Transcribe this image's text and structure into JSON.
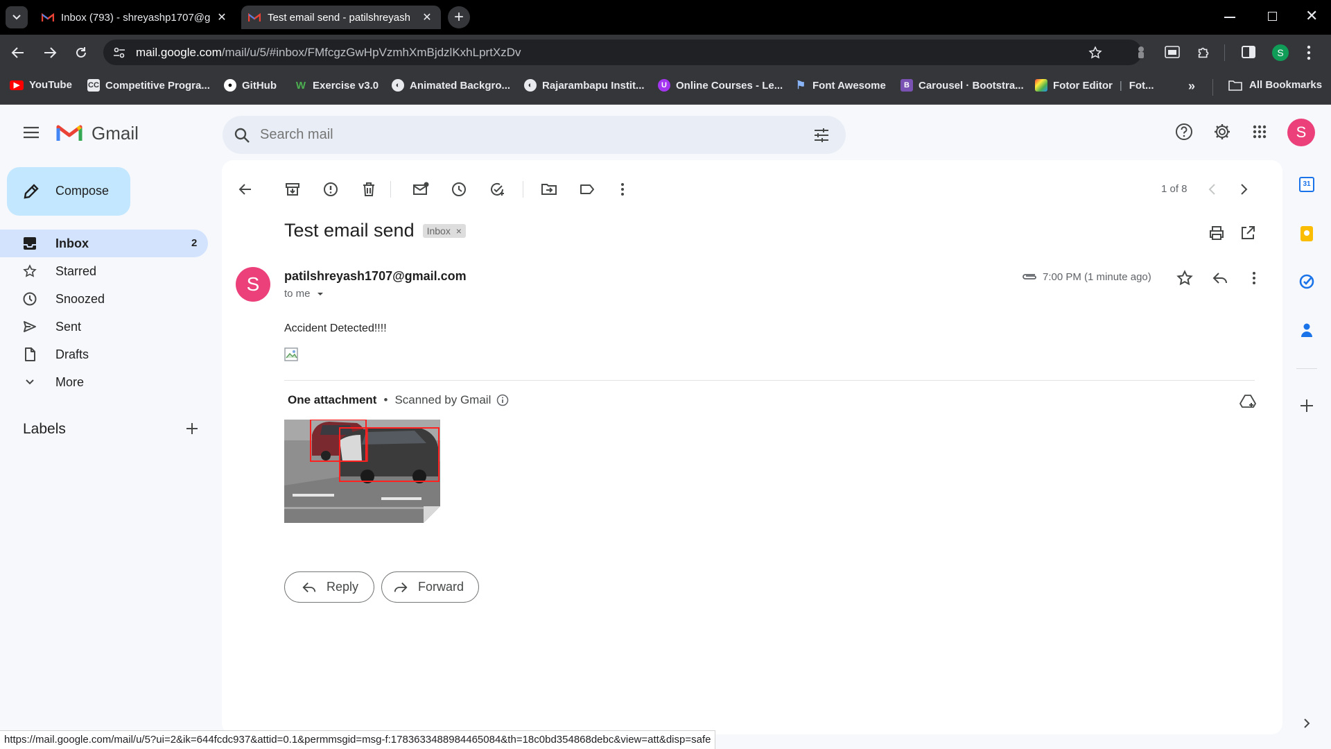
{
  "browser": {
    "tabs": [
      {
        "title": "Inbox (793) - shreyashp1707@g"
      },
      {
        "title": "Test email send - patilshreyash"
      }
    ],
    "url_host": "mail.google.com",
    "url_path": "/mail/u/5/#inbox/FMfcgzGwHpVzmhXmBjdzlKxhLprtXzDv",
    "profile_initial": "S",
    "bookmarks": [
      {
        "label": "YouTube"
      },
      {
        "label": "Competitive Progra..."
      },
      {
        "label": "GitHub"
      },
      {
        "label": "Exercise v3.0"
      },
      {
        "label": "Animated Backgro..."
      },
      {
        "label": "Rajarambapu Instit..."
      },
      {
        "label": "Online Courses - Le..."
      },
      {
        "label": "Font Awesome"
      },
      {
        "label": "Carousel · Bootstra..."
      },
      {
        "label": "Fotor Editor"
      },
      {
        "label": "Fot..."
      }
    ],
    "all_bookmarks": "All Bookmarks",
    "status_url": "https://mail.google.com/mail/u/5?ui=2&ik=644fcdc937&attid=0.1&permmsgid=msg-f:1783633488984465084&th=18c0bd354868debc&view=att&disp=safe"
  },
  "gmail": {
    "logo_text": "Gmail",
    "search_placeholder": "Search mail",
    "avatar_initial": "S",
    "compose": "Compose",
    "nav": [
      {
        "label": "Inbox",
        "count": "2"
      },
      {
        "label": "Starred"
      },
      {
        "label": "Snoozed"
      },
      {
        "label": "Sent"
      },
      {
        "label": "Drafts"
      },
      {
        "label": "More"
      }
    ],
    "labels_heading": "Labels",
    "pager": "1 of 8",
    "email": {
      "subject": "Test email send",
      "label_chip": "Inbox",
      "sender_initial": "S",
      "sender": "patilshreyash1707@gmail.com",
      "to": "to me",
      "time": "7:00 PM (1 minute ago)",
      "body": "Accident Detected!!!!",
      "attachment_title": "One attachment",
      "scanned": "Scanned by Gmail",
      "reply": "Reply",
      "forward": "Forward"
    }
  },
  "colors": {
    "accent": "#0b57d0",
    "nav_active": "#d3e3fd",
    "compose_bg": "#c2e7ff",
    "avatar": "#ec407a",
    "profile_avatar": "#0f9d58"
  }
}
